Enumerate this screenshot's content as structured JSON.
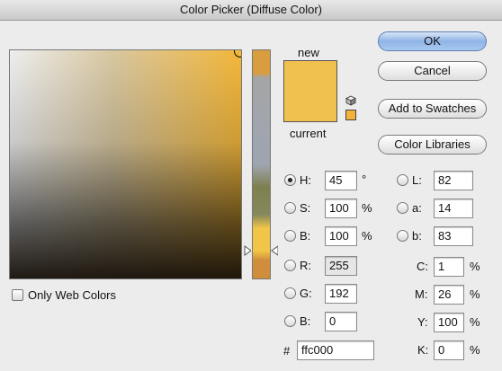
{
  "window": {
    "title": "Color Picker (Diffuse Color)"
  },
  "preview": {
    "new_label": "new",
    "current_label": "current",
    "new_color": "#f1c14f",
    "current_color": "#f1c14f",
    "swatch_color": "#f3b23a"
  },
  "buttons": {
    "ok": "OK",
    "cancel": "Cancel",
    "add_to_swatches": "Add to Swatches",
    "color_libraries": "Color Libraries"
  },
  "hsb": {
    "h": {
      "label": "H:",
      "value": "45",
      "unit": "°",
      "selected": true
    },
    "s": {
      "label": "S:",
      "value": "100",
      "unit": "%"
    },
    "b": {
      "label": "B:",
      "value": "100",
      "unit": "%"
    }
  },
  "rgb": {
    "r": {
      "label": "R:",
      "value": "255"
    },
    "g": {
      "label": "G:",
      "value": "192"
    },
    "b": {
      "label": "B:",
      "value": "0"
    }
  },
  "lab": {
    "l": {
      "label": "L:",
      "value": "82"
    },
    "a": {
      "label": "a:",
      "value": "14"
    },
    "b": {
      "label": "b:",
      "value": "83"
    }
  },
  "cmyk": {
    "c": {
      "label": "C:",
      "value": "1",
      "unit": "%"
    },
    "m": {
      "label": "M:",
      "value": "26",
      "unit": "%"
    },
    "y": {
      "label": "Y:",
      "value": "100",
      "unit": "%"
    },
    "k": {
      "label": "K:",
      "value": "0",
      "unit": "%"
    }
  },
  "hex": {
    "label": "#",
    "value": "ffc000"
  },
  "only_web_colors": {
    "label": "Only Web Colors",
    "checked": false
  }
}
